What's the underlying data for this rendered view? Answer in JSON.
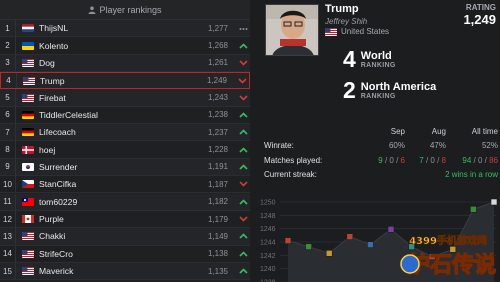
{
  "left_panel": {
    "header": "Player rankings",
    "players": [
      {
        "rank": "1",
        "name": "ThijsNL",
        "rating": "1,277",
        "trend": "flat",
        "flag": "nl"
      },
      {
        "rank": "2",
        "name": "Kolento",
        "rating": "1,268",
        "trend": "up",
        "flag": "ua"
      },
      {
        "rank": "3",
        "name": "Dog",
        "rating": "1,261",
        "trend": "down",
        "flag": "us"
      },
      {
        "rank": "4",
        "name": "Trump",
        "rating": "1,249",
        "trend": "down",
        "flag": "us",
        "selected": true
      },
      {
        "rank": "5",
        "name": "Firebat",
        "rating": "1,243",
        "trend": "down",
        "flag": "us"
      },
      {
        "rank": "6",
        "name": "TiddlerCelestial",
        "rating": "1,238",
        "trend": "up",
        "flag": "de"
      },
      {
        "rank": "7",
        "name": "Lifecoach",
        "rating": "1,237",
        "trend": "up",
        "flag": "de"
      },
      {
        "rank": "8",
        "name": "hoej",
        "rating": "1,228",
        "trend": "up",
        "flag": "dk"
      },
      {
        "rank": "9",
        "name": "Surrender",
        "rating": "1,191",
        "trend": "up",
        "flag": "kr"
      },
      {
        "rank": "10",
        "name": "StanCifka",
        "rating": "1,187",
        "trend": "down",
        "flag": "cz"
      },
      {
        "rank": "11",
        "name": "tom60229",
        "rating": "1,182",
        "trend": "up",
        "flag": "tw"
      },
      {
        "rank": "12",
        "name": "Purple",
        "rating": "1,179",
        "trend": "down",
        "flag": "ca"
      },
      {
        "rank": "13",
        "name": "Chakki",
        "rating": "1,149",
        "trend": "up",
        "flag": "us"
      },
      {
        "rank": "14",
        "name": "StrifeCro",
        "rating": "1,138",
        "trend": "up",
        "flag": "us"
      },
      {
        "rank": "15",
        "name": "Maverick",
        "rating": "1,135",
        "trend": "up",
        "flag": "us"
      }
    ]
  },
  "profile": {
    "name": "Trump",
    "real_name": "Jeffrey Shih",
    "country": "United States",
    "rating_label": "RATING",
    "rating": "1,249",
    "world_rank": "4",
    "world_label": "World",
    "world_sub": "RANKING",
    "region_rank": "2",
    "region_label": "North America",
    "region_sub": "RANKING"
  },
  "stats": {
    "columns": [
      "Sep",
      "Aug",
      "All time"
    ],
    "winrate_label": "Winrate:",
    "winrate": [
      "60%",
      "47%",
      "52%"
    ],
    "matches_label": "Matches played:",
    "matches": [
      {
        "w": "9",
        "d": "0",
        "l": "6"
      },
      {
        "w": "7",
        "d": "0",
        "l": "8"
      },
      {
        "w": "94",
        "d": "0",
        "l": "86"
      }
    ],
    "streak_label": "Current streak:",
    "streak": "2 wins in a row"
  },
  "chart_data": {
    "type": "line",
    "yticks": [
      "1250",
      "1248",
      "1246",
      "1244",
      "1242",
      "1240",
      "1238"
    ],
    "ylim": [
      1238,
      1250
    ],
    "values": [
      1244.2,
      1243.3,
      1242.3,
      1244.8,
      1243.6,
      1245.9,
      1243.3,
      1241.8,
      1242.9,
      1248.9,
      1250
    ],
    "grid": true
  },
  "watermark": {
    "site": "4399手机游戏网",
    "brand": "炉石传说"
  }
}
